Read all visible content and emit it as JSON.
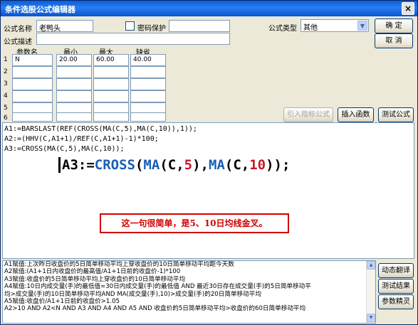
{
  "window": {
    "title": "条件选股公式编辑器",
    "close": "×"
  },
  "form": {
    "name_label": "公式名称",
    "name_value": "老鸭头",
    "password_label": "密码保护",
    "type_label": "公式类型",
    "type_value": "其他",
    "desc_label": "公式描述",
    "desc_value": ""
  },
  "buttons": {
    "ok": "确 定",
    "cancel": "取 消",
    "import_indicator": "引入指标公式",
    "insert_function": "插入函数",
    "test_formula": "测试公式",
    "dynamic_translate": "动态翻译",
    "test_result": "测试结果",
    "param_wizard": "参数精灵"
  },
  "params": {
    "headers": [
      "参数名",
      "最小",
      "最大",
      "缺省"
    ],
    "rows": [
      {
        "n": "1",
        "name": "N",
        "min": "20.00",
        "max": "60.00",
        "def": "40.00"
      },
      {
        "n": "2",
        "name": "",
        "min": "",
        "max": "",
        "def": ""
      },
      {
        "n": "3",
        "name": "",
        "min": "",
        "max": "",
        "def": ""
      },
      {
        "n": "4",
        "name": "",
        "min": "",
        "max": "",
        "def": ""
      },
      {
        "n": "5",
        "name": "",
        "min": "",
        "max": "",
        "def": ""
      },
      {
        "n": "6",
        "name": "",
        "min": "",
        "max": "",
        "def": ""
      }
    ]
  },
  "code": {
    "line1": "A1:=BARSLAST(REF(CROSS(MA(C,5),MA(C,10)),1));",
    "line2": "A2:=(HHV(C,A1+1)/REF(C,A1+1)-1)*100;",
    "line3": "A3:=CROSS(MA(C,5),MA(C,10));",
    "zoom": "A3:=CROSS(MA(C,5),MA(C,10));"
  },
  "annotation": "这一句很简单，是5、10日均线金叉。",
  "explanation": [
    "A1赋值:上次昨日收盘价的5日简单移动平均上穿收盘价的10日简单移动平均距今天数",
    "A2赋值:(A1+1日内收盘价的最高值/A1+1日前的收盘价-1)*100",
    "A3赋值:收盘价的5日简单移动平均上穿收盘价的10日简单移动平均",
    "A4赋值:10日内成交量(手)的最低值=30日内成交量(手)的最低值 AND 最近30日存在成交量(手)的5日简单移动平",
    "均>成交量(手)的10日简单移动平均AND MA(成交量(手),10)>成交量(手)的20日简单移动平均",
    "A5赋值:收盘价/A1+1日前的收盘价>1.05",
    "A2>10 AND A2<N AND A3 AND A4 AND A5 AND 收盘价的5日简单移动平均>收盘价的60日简单移动平均"
  ]
}
